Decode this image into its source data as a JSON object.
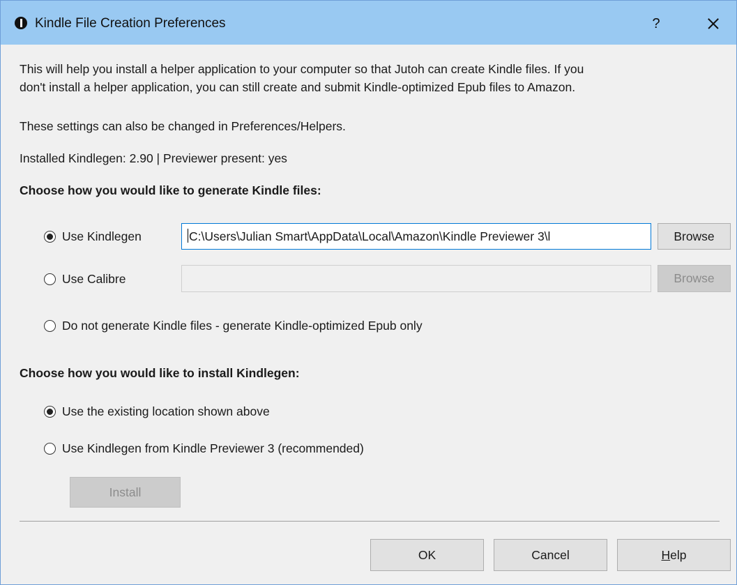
{
  "window": {
    "title": "Kindle File Creation Preferences",
    "help_glyph": "?",
    "close_icon": "close-icon"
  },
  "intro": {
    "line1": "This will help you install a helper application to your computer so that Jutoh can create Kindle files. If you",
    "line2": "don't install a helper application, you can still create and submit Kindle-optimized Epub files to Amazon.",
    "settings_note": "These settings can also be changed in Preferences/Helpers.",
    "installed_info": "Installed Kindlegen: 2.90 | Previewer present: yes"
  },
  "generate": {
    "heading": "Choose how you would like to generate Kindle files:",
    "selected": "kindlegen",
    "options": {
      "kindlegen": {
        "label": "Use Kindlegen",
        "path": "C:\\Users\\Julian Smart\\AppData\\Local\\Amazon\\Kindle Previewer 3\\l",
        "browse": "Browse"
      },
      "calibre": {
        "label": "Use Calibre",
        "path": "",
        "browse": "Browse"
      },
      "none": {
        "label": "Do not generate Kindle files - generate Kindle-optimized Epub only"
      }
    }
  },
  "install": {
    "heading": "Choose how you would like to install Kindlegen:",
    "selected": "existing",
    "options": {
      "existing": {
        "label": "Use the existing location shown above"
      },
      "previewer": {
        "label": "Use Kindlegen from Kindle Previewer 3 (recommended)"
      }
    },
    "install_button": "Install"
  },
  "footer": {
    "ok": "OK",
    "cancel": "Cancel",
    "help_mnemonic": "H",
    "help_rest": "elp"
  },
  "colors": {
    "titlebar": "#99c9f2",
    "window_bg": "#f0f0f0",
    "focus_border": "#0078d7"
  }
}
